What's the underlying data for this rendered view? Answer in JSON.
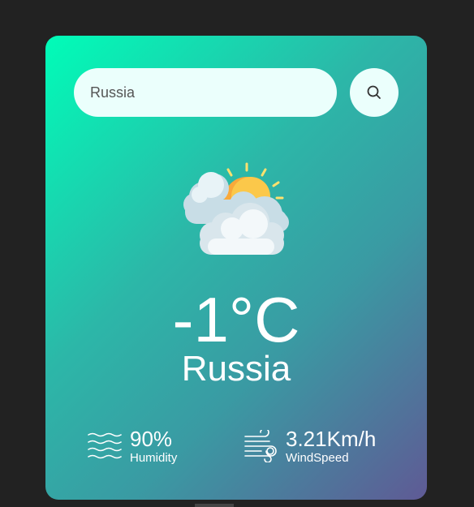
{
  "search": {
    "value": "Russia",
    "icon": "search-icon"
  },
  "weather": {
    "icon": "sun-behind-clouds-icon",
    "temperature": "-1°C",
    "city": "Russia"
  },
  "details": {
    "humidity_value": "90%",
    "humidity_label": "Humidity",
    "humidity_icon": "humidity-waves-icon",
    "wind_value": "3.21Km/h",
    "wind_label": "WindSpeed",
    "wind_icon": "wind-icon"
  },
  "colors": {
    "background": "#222222",
    "card_gradient_start": "#00fdb8",
    "card_gradient_end": "#5f5a95",
    "input_background": "#ebfffc",
    "text": "#ffffff"
  }
}
